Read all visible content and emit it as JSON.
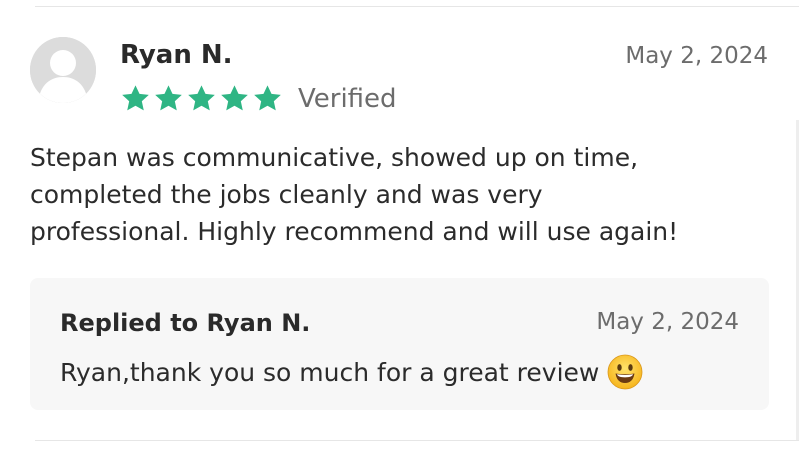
{
  "review": {
    "reviewer_name": "Ryan N.",
    "date": "May 2, 2024",
    "rating": 5,
    "rating_max": 5,
    "verified_label": "Verified",
    "body_lines": [
      "Stepan was communicative, showed up on time,",
      "completed the jobs cleanly and was very",
      "professional. Highly recommend and will use again!"
    ],
    "avatar_icon": "default-user-avatar-icon",
    "star_color": "#2fb584"
  },
  "reply": {
    "title": "Replied to Ryan N.",
    "date": "May 2, 2024",
    "text": "Ryan,thank you so much for a great review",
    "emoji_icon": "smiley-emoji-icon"
  },
  "colors": {
    "text_primary": "#2b2b2b",
    "text_secondary": "#6c6c6c",
    "reply_background": "#f7f7f7"
  }
}
